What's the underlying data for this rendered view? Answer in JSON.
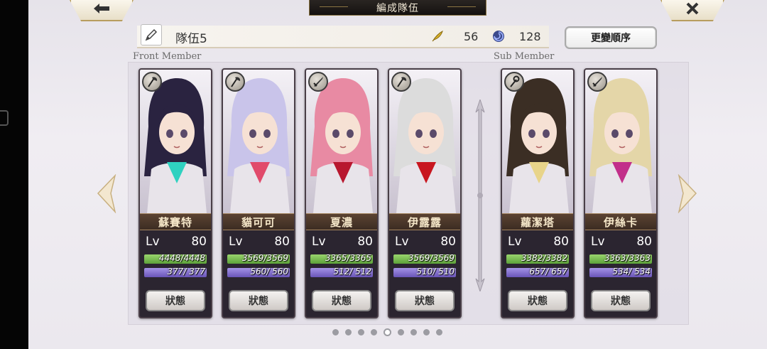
{
  "header": {
    "title": "編成隊伍",
    "back_icon": "back-arrow-icon",
    "close_icon": "close-icon"
  },
  "party": {
    "name": "隊伍5",
    "stat_a": "56",
    "stat_b": "128",
    "reorder_label": "更變順序"
  },
  "sections": {
    "front": "Front Member",
    "sub": "Sub Member"
  },
  "front_members": [
    {
      "name": "蘇賽特",
      "lv_label": "Lv",
      "level": "80",
      "hp": "4448/4448",
      "mp": "377/ 377",
      "hp_ratio": 1.0,
      "mp_ratio": 1.0,
      "weapon": "axe-icon",
      "status": "狀態",
      "hair": "#2a2340",
      "accent": "#2fd1c0"
    },
    {
      "name": "貓可可",
      "lv_label": "Lv",
      "level": "80",
      "hp": "3569/3569",
      "mp": "560/ 560",
      "hp_ratio": 1.0,
      "mp_ratio": 1.0,
      "weapon": "axe-icon",
      "status": "狀態",
      "hair": "#c9c4ea",
      "accent": "#e14a6b"
    },
    {
      "name": "夏濃",
      "lv_label": "Lv",
      "level": "80",
      "hp": "3365/3365",
      "mp": "512/ 512",
      "hp_ratio": 1.0,
      "mp_ratio": 1.0,
      "weapon": "sword-icon",
      "status": "狀態",
      "hair": "#e88aa3",
      "accent": "#b8172f"
    },
    {
      "name": "伊露露",
      "lv_label": "Lv",
      "level": "80",
      "hp": "3569/3569",
      "mp": "510/ 510",
      "hp_ratio": 1.0,
      "mp_ratio": 1.0,
      "weapon": "axe-icon",
      "status": "狀態",
      "hair": "#dcdcdc",
      "accent": "#c8161f"
    }
  ],
  "sub_members": [
    {
      "name": "蘿潔塔",
      "lv_label": "Lv",
      "level": "80",
      "hp": "3382/3382",
      "mp": "657/ 657",
      "hp_ratio": 1.0,
      "mp_ratio": 1.0,
      "weapon": "staff-icon",
      "status": "狀態",
      "hair": "#3b2e24",
      "accent": "#e8d48a"
    },
    {
      "name": "伊絲卡",
      "lv_label": "Lv",
      "level": "80",
      "hp": "3363/3363",
      "mp": "534/ 534",
      "hp_ratio": 1.0,
      "mp_ratio": 1.0,
      "weapon": "sword-icon",
      "status": "狀態",
      "hair": "#e4d6a8",
      "accent": "#c22f8a"
    }
  ],
  "pagination": {
    "total": 9,
    "current": 4
  }
}
